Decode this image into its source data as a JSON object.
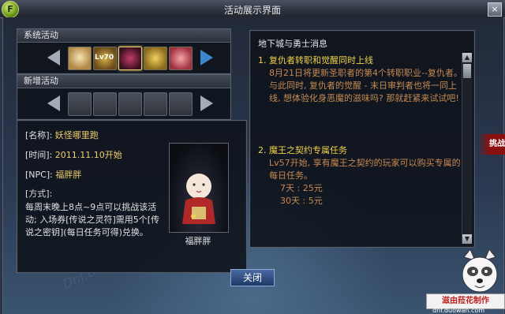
{
  "window": {
    "title": "活动展示界面",
    "close_glyph": "×",
    "corner_icon": "F"
  },
  "system_activities": {
    "label": "系统活动",
    "level_badge": "Lv70"
  },
  "new_activities": {
    "label": "新增活动"
  },
  "details": {
    "name_label": "[名称]:",
    "name_value": "妖怪哪里跑",
    "time_label": "[时间]:",
    "time_value": "2011.11.10开始",
    "npc_label": "[NPC]:",
    "npc_value": "福胖胖",
    "method_label": "[方式]:",
    "description": "每周末晚上8点~9点可以挑战该活动; 入场券[传说之灵符]需用5个[传说之密钥](每日任务可得)兑换。",
    "portrait_name": "福胖胖"
  },
  "news": {
    "header": "地下城与勇士消息",
    "item1_title": "1. 复仇者转职和觉醒同时上线",
    "item1_body": "8月21日将更新圣职者的第4个转职职业--复仇者。",
    "item1_body2": "与此同时, 复仇者的觉醒 - 末日审判者也将一同上线, 想体验化身恶魔的滋味吗? 那就赶紧来试试吧!",
    "item2_title": "2. 魔王之契约专属任务",
    "item2_body": "Lv57开始, 享有魔王之契约的玩家可以购买专属的每日任务。",
    "item2_price1": "7天 : 25元",
    "item2_price2": "30天 : 5元"
  },
  "buttons": {
    "close_label": "关闭"
  },
  "overlay": {
    "side_tag": "挑战",
    "mascot_label": "滋由菈花制作",
    "mascot_url": "dnf.duowan.com",
    "watermark": "Dnf.Duowan.Com"
  }
}
